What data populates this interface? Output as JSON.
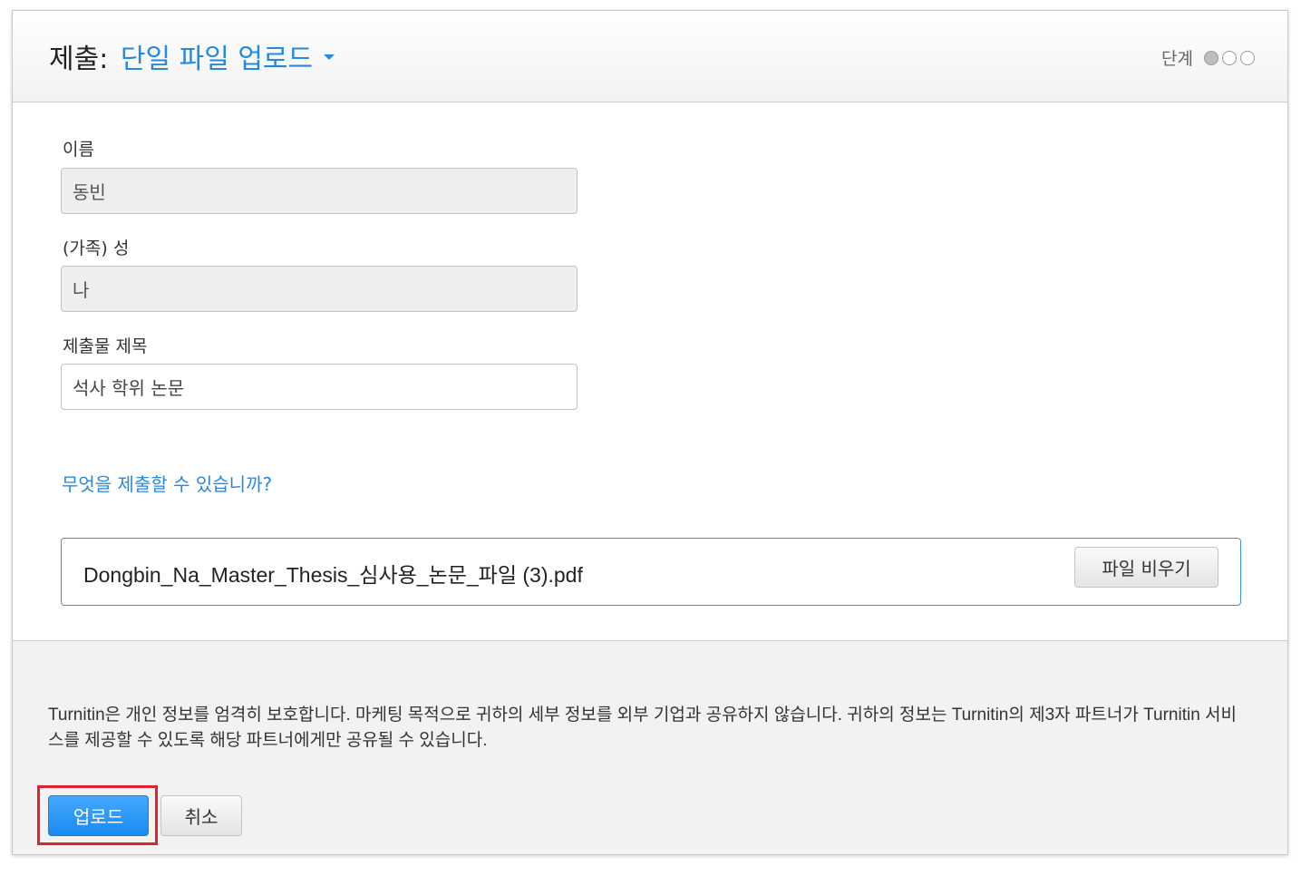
{
  "header": {
    "title_prefix": "제출:",
    "submission_type": "단일 파일 업로드",
    "steps_label": "단계",
    "steps_total": 3,
    "current_step": 1
  },
  "form": {
    "first_name_label": "이름",
    "first_name_value": "동빈",
    "last_name_label": "(가족) 성",
    "last_name_value": "나",
    "title_label": "제출물 제목",
    "title_value": "석사 학위 논문"
  },
  "what_link": "무엇을 제출할 수 있습니까?",
  "file": {
    "name": "Dongbin_Na_Master_Thesis_심사용_논문_파일 (3).pdf",
    "clear_label": "파일 비우기"
  },
  "footer": {
    "privacy_text": "Turnitin은 개인 정보를 엄격히 보호합니다. 마케팅 목적으로 귀하의 세부 정보를 외부 기업과 공유하지 않습니다. 귀하의 정보는 Turnitin의 제3자 파트너가 Turnitin 서비스를 제공할 수 있도록 해당 파트너에게만 공유될 수 있습니다.",
    "upload_label": "업로드",
    "cancel_label": "취소"
  },
  "colors": {
    "accent": "#2489e0",
    "highlight": "#e2212e"
  }
}
